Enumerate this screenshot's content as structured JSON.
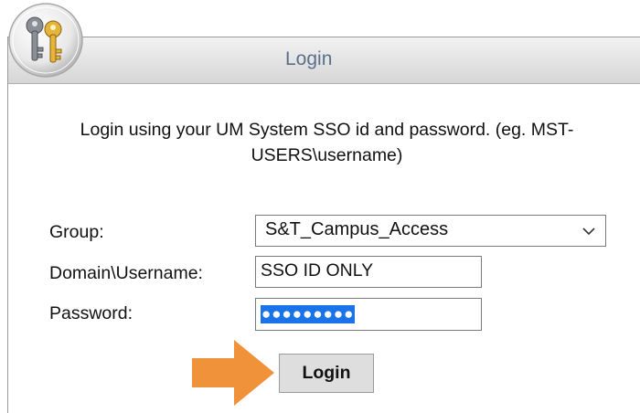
{
  "dialog": {
    "title": "Login",
    "instructions": "Login using your UM System SSO id and password. (eg. MST-USERS\\username)"
  },
  "form": {
    "group_label": "Group:",
    "group_value": "S&T_Campus_Access",
    "username_label": "Domain\\Username:",
    "username_value": "SSO ID ONLY",
    "password_label": "Password:",
    "password_mask": "●●●●●●●●●"
  },
  "login_button": "Login",
  "icons": {
    "title_icon": "keys-icon",
    "dropdown": "chevron-down-icon",
    "annotation": "orange-arrow-icon"
  },
  "colors": {
    "title_text": "#5a6f8a",
    "password_highlight": "#1a73e8",
    "arrow": "#f0923a"
  }
}
